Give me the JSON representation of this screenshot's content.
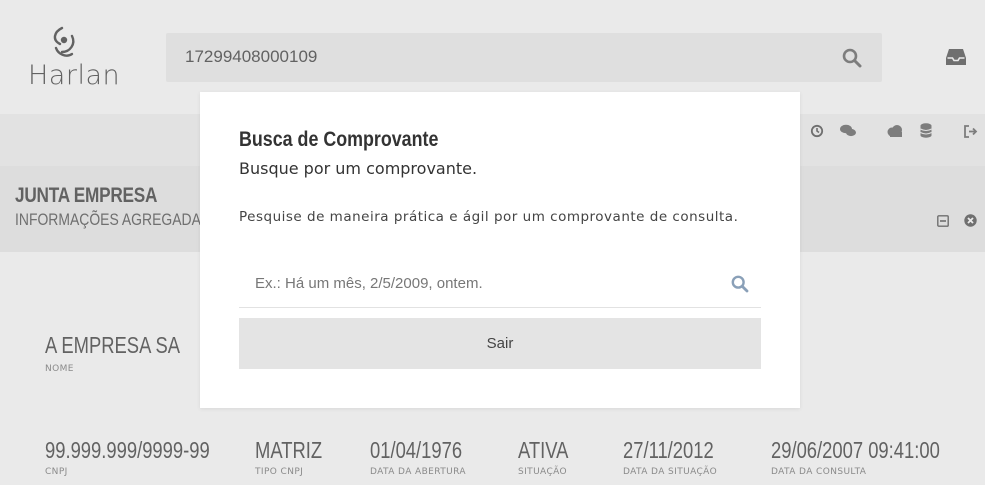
{
  "header": {
    "logo_text": "Harlan",
    "search_value": "17299408000109"
  },
  "section": {
    "title": "JUNTA EMPRESA",
    "subtitle": "INFORMAÇÕES AGREGADAS DO"
  },
  "company": {
    "name": "A EMPRESA SA",
    "name_label": "NOME"
  },
  "fields": [
    {
      "value": "99.999.999/9999-99",
      "label": "CNPJ"
    },
    {
      "value": "MATRIZ",
      "label": "TIPO CNPJ"
    },
    {
      "value": "01/04/1976",
      "label": "DATA DA ABERTURA"
    },
    {
      "value": "ATIVA",
      "label": "SITUAÇÃO"
    },
    {
      "value": "27/11/2012",
      "label": "DATA DA SITUAÇÃO"
    },
    {
      "value": "29/06/2007 09:41:00",
      "label": "DATA DA CONSULTA"
    }
  ],
  "modal": {
    "title": "Busca de Comprovante",
    "subtitle": "Busque por um comprovante.",
    "description": "Pesquise de maneira prática e ágil por um comprovante de consulta.",
    "input_placeholder": "Ex.: Há um mês, 2/5/2009, ontem.",
    "input_value": "",
    "exit_label": "Sair"
  },
  "icons": {
    "search": "search-icon",
    "inbox": "inbox-icon",
    "history": "history-icon",
    "chat": "chat-icon",
    "cloud": "cloud-icon",
    "database": "database-icon",
    "logout": "logout-icon",
    "minimize": "minimize-icon",
    "close": "close-icon"
  },
  "colors": {
    "overlay": "#969696",
    "exit_button": "#e4e4e4",
    "search_box": "#f2f2f2"
  }
}
